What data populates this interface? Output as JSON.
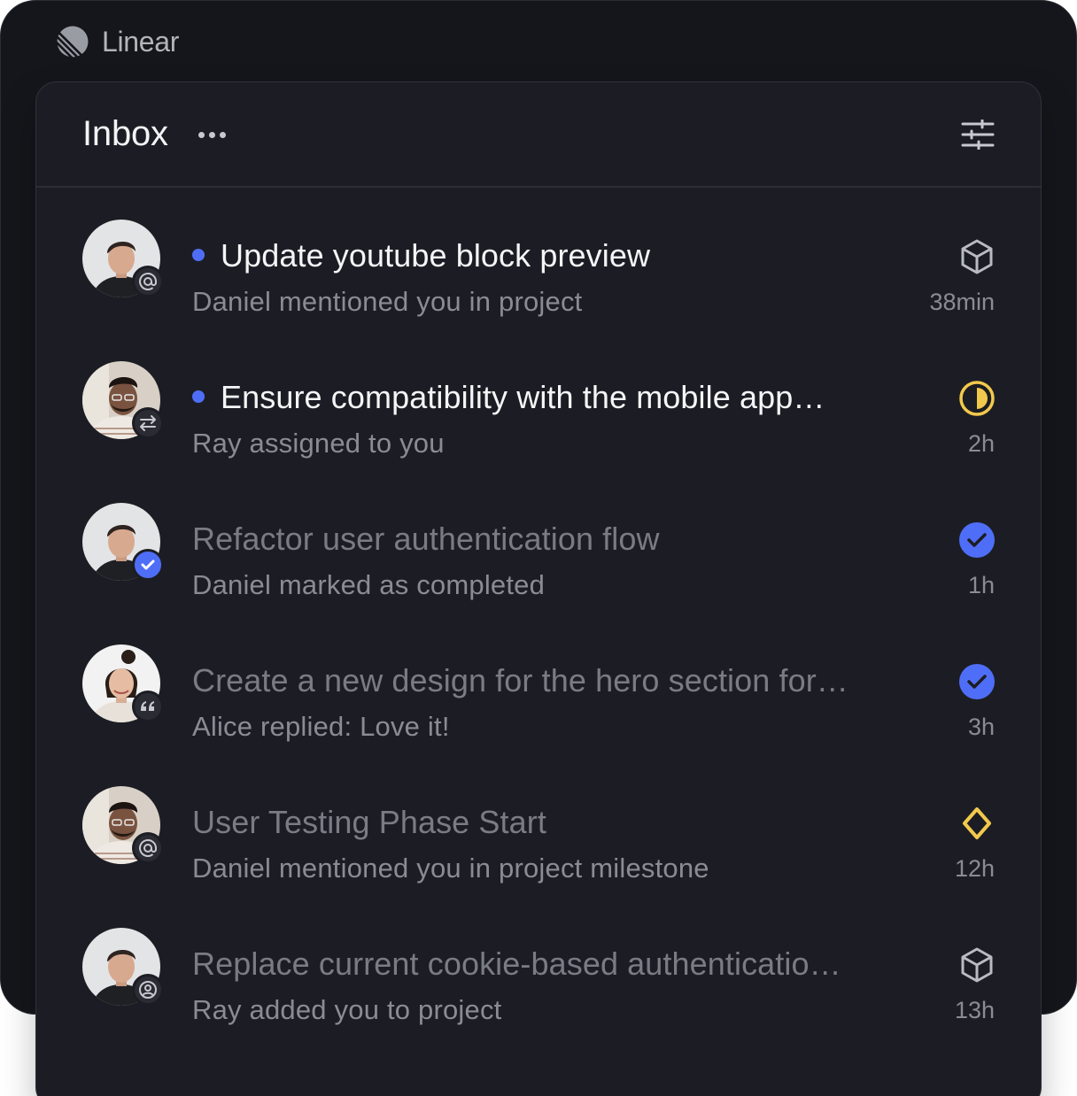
{
  "app": {
    "name": "Linear"
  },
  "inbox": {
    "title": "Inbox"
  },
  "notifications": [
    {
      "title": "Update youtube block preview",
      "subtitle": "Daniel mentioned you in project",
      "time": "38min",
      "unread": true,
      "avatar": "daniel",
      "badge": "at-icon",
      "status": "project-cube-icon"
    },
    {
      "title": "Ensure compatibility with the mobile app…",
      "subtitle": "Ray assigned to you",
      "time": "2h",
      "unread": true,
      "avatar": "ray",
      "badge": "swap-arrows-icon",
      "status": "in-progress-half-circle-icon"
    },
    {
      "title": "Refactor user authentication flow",
      "subtitle": "Daniel marked as completed",
      "time": "1h",
      "unread": false,
      "avatar": "daniel",
      "badge": "check-icon",
      "status": "done-check-circle-icon"
    },
    {
      "title": "Create a new design for the hero section for…",
      "subtitle": "Alice replied: Love it!",
      "time": "3h",
      "unread": false,
      "avatar": "alice",
      "badge": "quote-icon",
      "status": "done-check-circle-icon"
    },
    {
      "title": "User Testing Phase Start",
      "subtitle": "Daniel mentioned you in project milestone",
      "time": "12h",
      "unread": false,
      "avatar": "ray",
      "badge": "at-icon",
      "status": "milestone-diamond-icon"
    },
    {
      "title": "Replace current cookie-based authenticatio…",
      "subtitle": "Ray added you to project",
      "time": "13h",
      "unread": false,
      "avatar": "daniel",
      "badge": "user-circle-icon",
      "status": "project-cube-icon"
    }
  ],
  "colors": {
    "accent": "#4f6ef7",
    "in_progress": "#f2c94c",
    "background": "#1c1d24"
  }
}
